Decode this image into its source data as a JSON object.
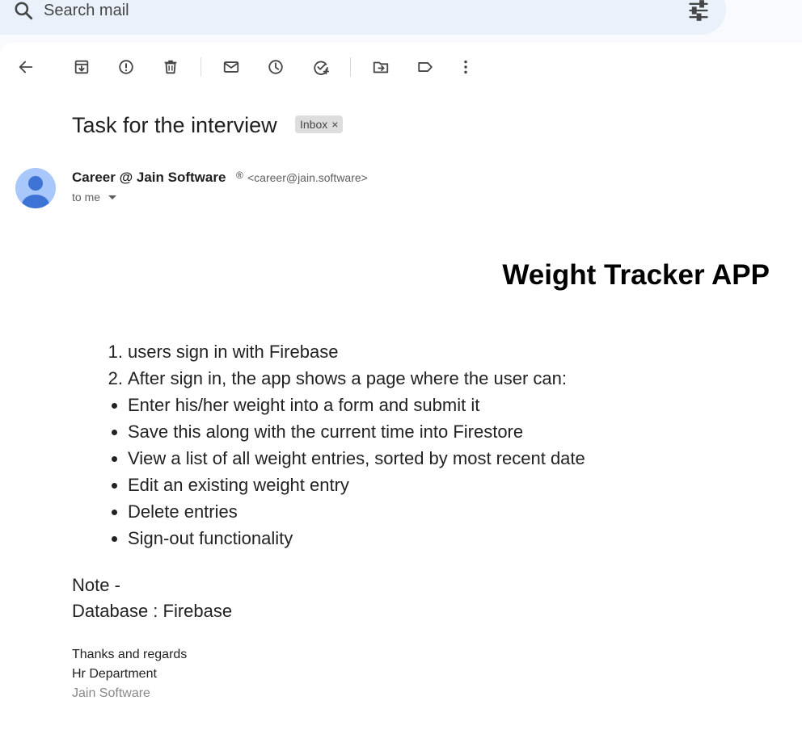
{
  "search": {
    "placeholder": "Search mail",
    "icon": "search-icon",
    "options_icon": "tune-icon"
  },
  "toolbar": {
    "icons": [
      "back-arrow-icon",
      "archive-icon",
      "report-spam-icon",
      "delete-icon",
      "mark-unread-icon",
      "snooze-icon",
      "add-to-tasks-icon",
      "move-to-icon",
      "labels-icon",
      "more-vert-icon"
    ]
  },
  "message": {
    "subject": "Task for the interview",
    "label": "Inbox",
    "sender_name": "Career @ Jain Software",
    "reg_mark": "®",
    "sender_email": "<career@jain.software>",
    "to": "to me",
    "heading": "Weight Tracker APP",
    "numbered": [
      {
        "marker": "1.",
        "text": "users sign in with Firebase"
      },
      {
        "marker": "2.",
        "text": "After sign in, the app shows a page where the user can:"
      }
    ],
    "bullets": [
      "Enter his/her weight into a form and submit it",
      "Save this along with the current time into Firestore",
      "View a list of all weight entries, sorted by most recent date",
      "Edit an existing weight entry",
      "Delete entries",
      "Sign-out functionality"
    ],
    "note": "Note -",
    "database": "Database : Firebase",
    "signature": [
      "Thanks and regards",
      "Hr Department",
      "Jain Software"
    ]
  },
  "colors": {
    "search_bg": "#eaf1fb",
    "avatar_bg": "#a8c7fa",
    "avatar_fg": "#3e73d6",
    "chip_bg": "#dddddd"
  }
}
